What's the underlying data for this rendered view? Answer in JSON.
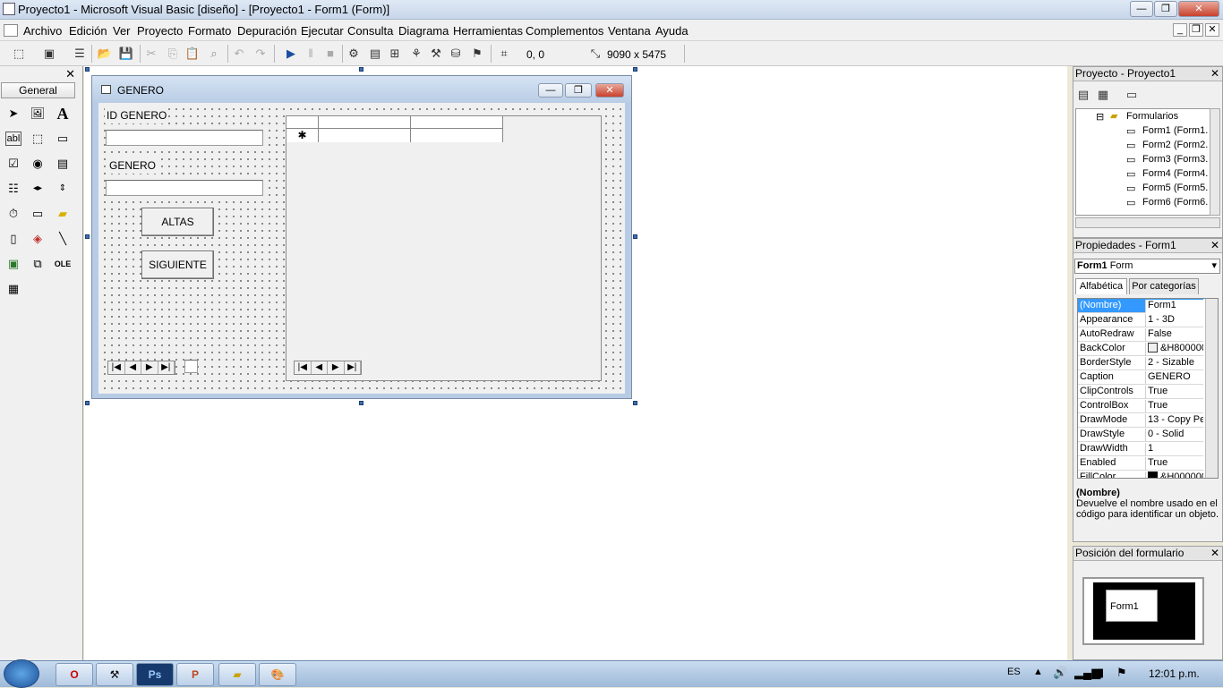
{
  "window": {
    "title": "Proyecto1 - Microsoft Visual Basic [diseño] - [Proyecto1 - Form1 (Form)]"
  },
  "menu": [
    "Archivo",
    "Edición",
    "Ver",
    "Proyecto",
    "Formato",
    "Depuración",
    "Ejecutar",
    "Consulta",
    "Diagrama",
    "Herramientas",
    "Complementos",
    "Ventana",
    "Ayuda"
  ],
  "toolbar": {
    "position": "0, 0",
    "size": "9090 x 5475"
  },
  "toolbox": {
    "title": "General"
  },
  "form": {
    "caption": "GENERO",
    "label_id": "ID GENERO",
    "label_genero": "GENERO",
    "btn_altas": "ALTAS",
    "btn_siguiente": "SIGUIENTE",
    "grid_newrow": "✱"
  },
  "project": {
    "title": "Proyecto - Proyecto1",
    "folder": "Formularios",
    "forms": [
      "Form1 (Form1.",
      "Form2 (Form2.",
      "Form3 (Form3.",
      "Form4 (Form4.",
      "Form5 (Form5.",
      "Form6 (Form6."
    ]
  },
  "properties": {
    "title": "Propiedades - Form1",
    "object_name": "Form1",
    "object_type": "Form",
    "tab_alpha": "Alfabética",
    "tab_cat": "Por categorías",
    "rows": [
      {
        "k": "(Nombre)",
        "v": "Form1"
      },
      {
        "k": "Appearance",
        "v": "1 - 3D"
      },
      {
        "k": "AutoRedraw",
        "v": "False"
      },
      {
        "k": "BackColor",
        "v": "&H8000000"
      },
      {
        "k": "BorderStyle",
        "v": "2 - Sizable"
      },
      {
        "k": "Caption",
        "v": "GENERO"
      },
      {
        "k": "ClipControls",
        "v": "True"
      },
      {
        "k": "ControlBox",
        "v": "True"
      },
      {
        "k": "DrawMode",
        "v": "13 - Copy Pen"
      },
      {
        "k": "DrawStyle",
        "v": "0 - Solid"
      },
      {
        "k": "DrawWidth",
        "v": "1"
      },
      {
        "k": "Enabled",
        "v": "True"
      },
      {
        "k": "FillColor",
        "v": "&H000000"
      }
    ],
    "desc_title": "(Nombre)",
    "desc_text": "Devuelve el nombre usado en el código para identificar un objeto."
  },
  "position_window": {
    "title": "Posición del formulario",
    "form_label": "Form1"
  },
  "taskbar": {
    "lang": "ES",
    "time": "12:01 p.m."
  }
}
